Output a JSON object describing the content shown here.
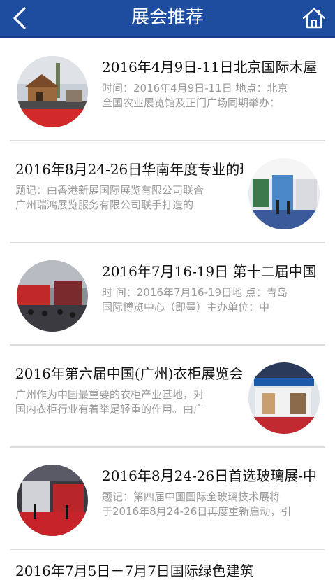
{
  "header": {
    "title": "展会推荐",
    "back_icon": "chevron-left-icon",
    "home_icon": "home-icon",
    "background": "#1e4da0"
  },
  "items": [
    {
      "title": "2016年4月9日-11日北京国际木屋",
      "desc_line1": "时间：2016年4月9日-11日 地点：北京",
      "desc_line2": "全国农业展览馆及正门广场同期举办：",
      "image": "wooden-house-expo-photo"
    },
    {
      "title": "2016年8月24-26日华南年度专业的玻",
      "desc_line1": "题记：由香港新展国际展览有限公司联合",
      "desc_line2": "广州瑞鸿展览服务有限公司联手打造的",
      "image": "exhibition-hall-photo"
    },
    {
      "title": "2016年7月16-19日 第十二届中国",
      "desc_line1": "时 间：2016年7月16-19日地 点：青岛",
      "desc_line2": "国际博览中心（即墨）主办单位：中",
      "image": "crowd-entrance-photo"
    },
    {
      "title": "2016年第六届中国(广州)衣柜展览会",
      "desc_line1": "广州作为中国最重要的衣柜产业基地，对",
      "desc_line2": "国内衣柜行业有着举足轻重的作用。由广",
      "image": "booth-display-photo"
    },
    {
      "title": "2016年8月24-26日首选玻璃展-中",
      "desc_line1": "题记：第四届中国国际全玻璃技术展将",
      "desc_line2": "于2016年8月24-26日再度重新启动，引",
      "image": "glass-expo-photo"
    },
    {
      "title": "2016年7月5日－7月7日国际绿色建筑"
    }
  ]
}
